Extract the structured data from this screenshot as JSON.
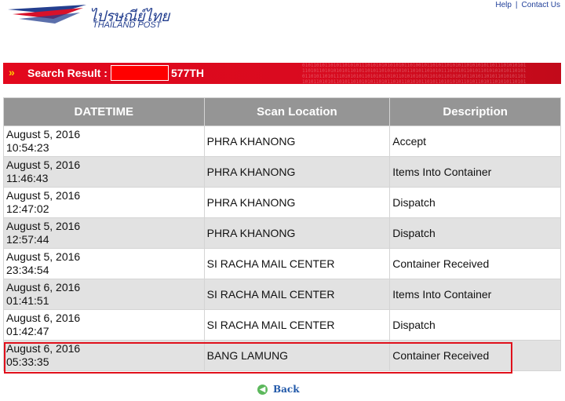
{
  "header": {
    "logo_thai": "ไปรษณีย์ไทย",
    "logo_en": "THAILAND POST",
    "links": [
      "Help",
      "Contact Us"
    ]
  },
  "search": {
    "arrow_icon": "double-chevron-right-icon",
    "label": "Search Result :",
    "code_suffix": "577TH"
  },
  "table": {
    "columns": [
      "DATETIME",
      "Scan Location",
      "Description"
    ],
    "rows": [
      {
        "date": "August 5, 2016",
        "time": "10:54:23",
        "location": "PHRA KHANONG",
        "description": "Accept"
      },
      {
        "date": "August 5, 2016",
        "time": "11:46:43",
        "location": "PHRA KHANONG",
        "description": "Items Into Container"
      },
      {
        "date": "August 5, 2016",
        "time": "12:47:02",
        "location": "PHRA KHANONG",
        "description": "Dispatch"
      },
      {
        "date": "August 5, 2016",
        "time": "12:57:44",
        "location": "PHRA KHANONG",
        "description": "Dispatch"
      },
      {
        "date": "August 5, 2016",
        "time": "23:34:54",
        "location": "SI RACHA MAIL CENTER",
        "description": "Container Received"
      },
      {
        "date": "August 6, 2016",
        "time": "01:41:51",
        "location": "SI RACHA MAIL CENTER",
        "description": "Items Into Container"
      },
      {
        "date": "August 6, 2016",
        "time": "01:42:47",
        "location": "SI RACHA MAIL CENTER",
        "description": "Dispatch"
      },
      {
        "date": "August 6, 2016",
        "time": "05:33:35",
        "location": "BANG LAMUNG",
        "description": "Container Received"
      }
    ]
  },
  "back": {
    "label": "Back",
    "icon": "back-arrow-icon"
  },
  "colors": {
    "banner_red": "#e3081d",
    "header_gray": "#959595",
    "row_alt": "#e2e2e2",
    "highlight": "#e0101c",
    "brand_blue": "#243f8f"
  }
}
